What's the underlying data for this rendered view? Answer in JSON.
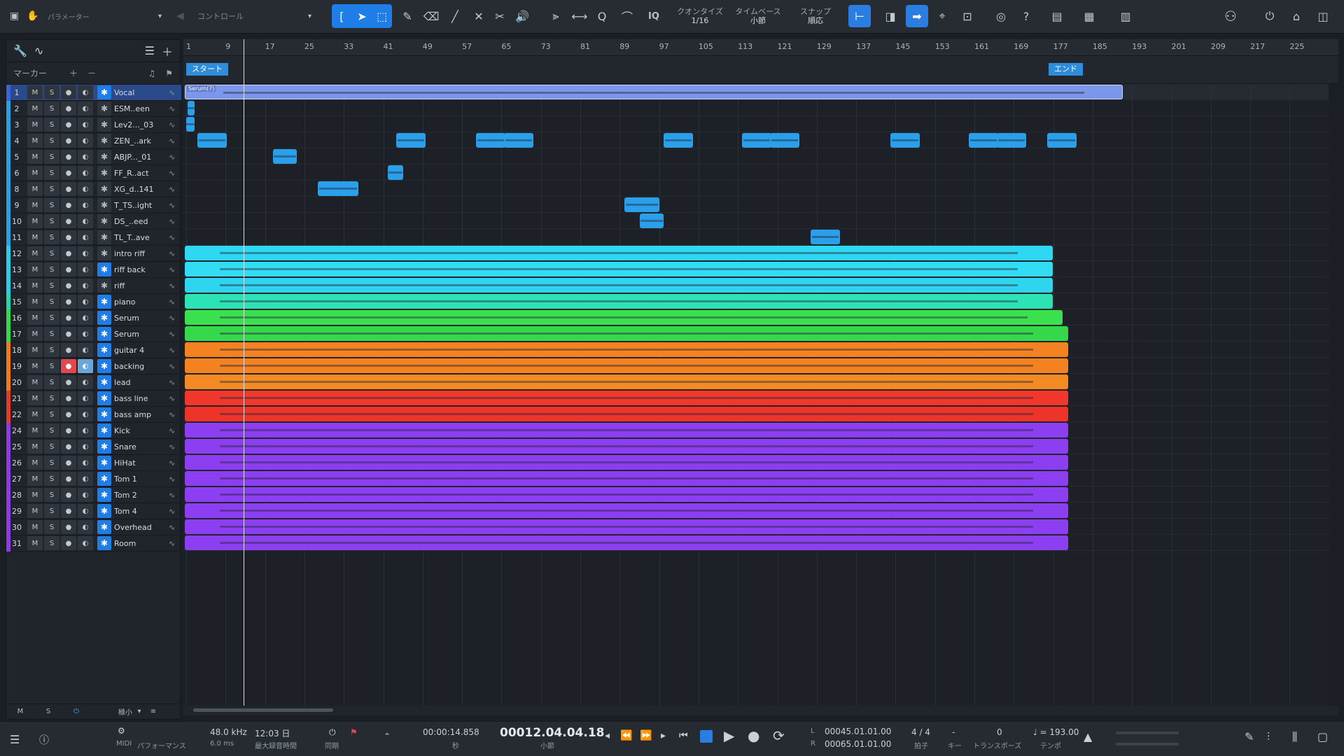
{
  "toolbar": {
    "left_label_1": "パラメーター",
    "left_label_2": "コントロール",
    "quantize_label": "クオンタイズ",
    "quantize_value": "1/16",
    "timebase_label": "タイムベース",
    "timebase_value": "小節",
    "snap_label": "スナップ",
    "snap_value": "順応",
    "iq_label": "IQ",
    "help_label": "?"
  },
  "left": {
    "marker_label": "マーカー",
    "footer": {
      "m": "M",
      "s": "S",
      "zoom": "極小"
    }
  },
  "tracks": [
    {
      "n": "1",
      "name": "Vocal",
      "color": "#3a63d8",
      "inst": true
    },
    {
      "n": "2",
      "name": "ESM..een",
      "color": "#29a0e6",
      "inst": false
    },
    {
      "n": "3",
      "name": "Lev2..._03",
      "color": "#29a0e6",
      "inst": false
    },
    {
      "n": "4",
      "name": "ZEN_..ark",
      "color": "#29a0e6",
      "inst": false
    },
    {
      "n": "5",
      "name": "ABJP..._01",
      "color": "#29a0e6",
      "inst": false
    },
    {
      "n": "6",
      "name": "FF_R..act",
      "color": "#29a0e6",
      "inst": false
    },
    {
      "n": "8",
      "name": "XG_d..141",
      "color": "#29a0e6",
      "inst": false
    },
    {
      "n": "9",
      "name": "T_TS..ight",
      "color": "#29a0e6",
      "inst": false
    },
    {
      "n": "10",
      "name": "DS_..eed",
      "color": "#29a0e6",
      "inst": false
    },
    {
      "n": "11",
      "name": "TL_T..ave",
      "color": "#29a0e6",
      "inst": false
    },
    {
      "n": "12",
      "name": "intro riff",
      "color": "#2ccbe8",
      "inst": false
    },
    {
      "n": "13",
      "name": "riff back",
      "color": "#2ccbe8",
      "inst": true
    },
    {
      "n": "14",
      "name": "riff",
      "color": "#2ccbe8",
      "inst": false
    },
    {
      "n": "15",
      "name": "piano",
      "color": "#22d8a8",
      "inst": true
    },
    {
      "n": "16",
      "name": "Serum",
      "color": "#34d84a",
      "inst": true
    },
    {
      "n": "17",
      "name": "Serum",
      "color": "#34d84a",
      "inst": true
    },
    {
      "n": "18",
      "name": "guitar 4",
      "color": "#f07a1c",
      "inst": true
    },
    {
      "n": "19",
      "name": "backing",
      "color": "#f07a1c",
      "inst": true,
      "rec": true,
      "mon": true
    },
    {
      "n": "20",
      "name": "lead",
      "color": "#f07a1c",
      "inst": true
    },
    {
      "n": "21",
      "name": "bass line",
      "color": "#e43a2c",
      "inst": true
    },
    {
      "n": "22",
      "name": "bass amp",
      "color": "#e43a2c",
      "inst": true
    },
    {
      "n": "24",
      "name": "Kick",
      "color": "#8b3be6",
      "inst": true
    },
    {
      "n": "25",
      "name": "Snare",
      "color": "#8b3be6",
      "inst": true
    },
    {
      "n": "26",
      "name": "HiHat",
      "color": "#8b3be6",
      "inst": true
    },
    {
      "n": "27",
      "name": "Tom 1",
      "color": "#8b3be6",
      "inst": true
    },
    {
      "n": "28",
      "name": "Tom 2",
      "color": "#8b3be6",
      "inst": true
    },
    {
      "n": "29",
      "name": "Tom 4",
      "color": "#8b3be6",
      "inst": true
    },
    {
      "n": "30",
      "name": "Overhead",
      "color": "#8b3be6",
      "inst": true
    },
    {
      "n": "31",
      "name": "Room",
      "color": "#8b3be6",
      "inst": true
    }
  ],
  "ruler": [
    "1",
    "9",
    "17",
    "25",
    "33",
    "41",
    "49",
    "57",
    "65",
    "73",
    "81",
    "89",
    "97",
    "105",
    "113",
    "121",
    "129",
    "137",
    "145",
    "153",
    "161",
    "169",
    "177",
    "185",
    "193",
    "201",
    "209",
    "217",
    "225"
  ],
  "markers": {
    "start": "スタート",
    "end": "エンド"
  },
  "vocal_clip": "Serum(7)",
  "bottom": {
    "midi": "MIDI",
    "perf": "パフォーマンス",
    "rate": "48.0 kHz",
    "latency": "6.0 ms",
    "rec_time": "12:03 日",
    "rec_time_label": "最大録音時間",
    "sync": "同期",
    "time_seconds": "00:00:14.858",
    "time_seconds_unit": "秒",
    "position": "00012.04.04.18",
    "position_unit": "小節",
    "loop_l": "00045.01.01.00",
    "loop_r": "00065.01.01.00",
    "sig": "4 / 4",
    "sig_label": "拍子",
    "key": "-",
    "key_label": "キー",
    "transpose": "0",
    "transpose_label": "トランスポーズ",
    "tempo": "♩ = 193.00",
    "tempo_label": "テンポ"
  }
}
